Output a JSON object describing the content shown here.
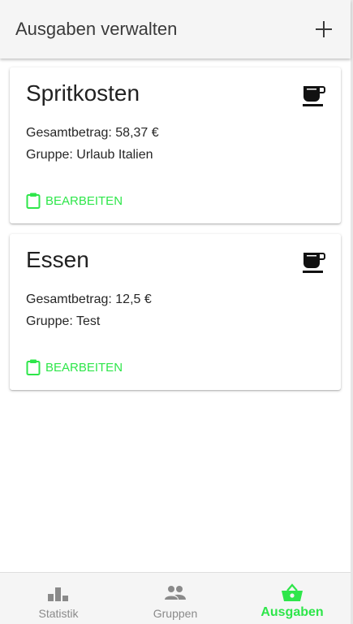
{
  "header": {
    "title": "Ausgaben verwalten",
    "add_icon": "plus-icon"
  },
  "colors": {
    "accent": "#2ee64a",
    "header_bg": "#f5f5f5",
    "inactive_nav": "#8a8a8a"
  },
  "expenses": [
    {
      "title": "Spritkosten",
      "icon": "coffee-cup-icon",
      "total": "Gesamtbetrag: 58,37 €",
      "group": "Gruppe: Urlaub Italien",
      "edit_label": "BEARBEITEN"
    },
    {
      "title": "Essen",
      "icon": "coffee-cup-icon",
      "total": "Gesamtbetrag: 12,5 €",
      "group": "Gruppe: Test",
      "edit_label": "BEARBEITEN"
    }
  ],
  "bottom_nav": {
    "items": [
      {
        "label": "Statistik",
        "icon": "bar-chart-icon",
        "active": false
      },
      {
        "label": "Gruppen",
        "icon": "people-icon",
        "active": false
      },
      {
        "label": "Ausgaben",
        "icon": "basket-icon",
        "active": true
      }
    ]
  }
}
